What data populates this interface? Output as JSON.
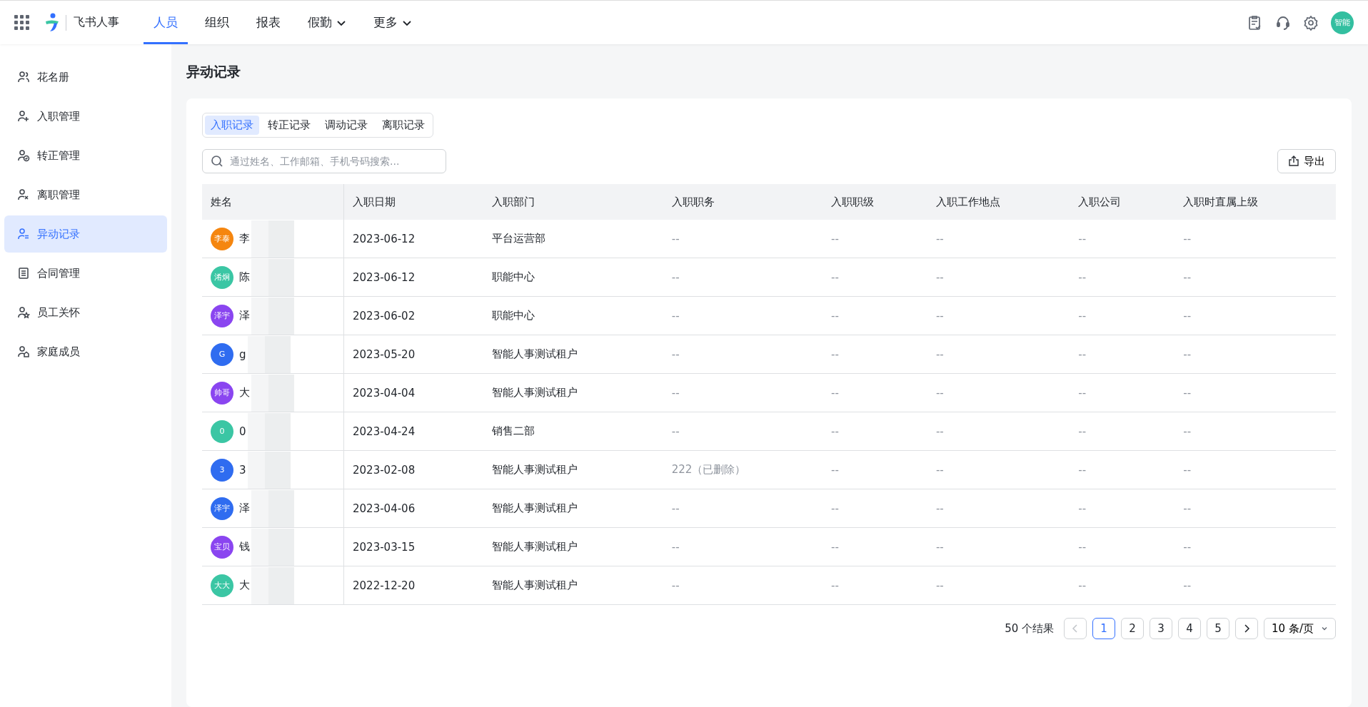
{
  "app": {
    "name": "飞书人事"
  },
  "nav": [
    {
      "label": "人员",
      "selected": true,
      "dropdown": false
    },
    {
      "label": "组织",
      "selected": false,
      "dropdown": false
    },
    {
      "label": "报表",
      "selected": false,
      "dropdown": false
    },
    {
      "label": "假勤",
      "selected": false,
      "dropdown": true
    },
    {
      "label": "更多",
      "selected": false,
      "dropdown": true
    }
  ],
  "user": {
    "avatar": "智能"
  },
  "sidebar": {
    "items": [
      {
        "label": "花名册",
        "kind": "people",
        "selected": false
      },
      {
        "label": "入职管理",
        "kind": "add",
        "selected": false
      },
      {
        "label": "转正管理",
        "kind": "check",
        "selected": false
      },
      {
        "label": "离职管理",
        "kind": "remove",
        "selected": false
      },
      {
        "label": "异动记录",
        "kind": "swap",
        "selected": true
      },
      {
        "label": "合同管理",
        "kind": "doc",
        "selected": false
      },
      {
        "label": "员工关怀",
        "kind": "star",
        "selected": false
      },
      {
        "label": "家庭成员",
        "kind": "home",
        "selected": false
      }
    ]
  },
  "page": {
    "title": "异动记录"
  },
  "tabs": [
    {
      "label": "入职记录",
      "selected": true
    },
    {
      "label": "转正记录",
      "selected": false
    },
    {
      "label": "调动记录",
      "selected": false
    },
    {
      "label": "离职记录",
      "selected": false
    }
  ],
  "search": {
    "placeholder": "通过姓名、工作邮箱、手机号码搜索..."
  },
  "export_button": "导出",
  "table": {
    "columns": [
      "姓名",
      "入职日期",
      "入职部门",
      "入职职务",
      "入职职级",
      "入职工作地点",
      "入职公司",
      "入职时直属上级"
    ],
    "rows": [
      {
        "avatar": "李泰",
        "color": "#f5860f",
        "cells": [
          "李",
          "2023-06-12",
          "平台运营部",
          "--",
          "--",
          "--",
          "--",
          "--"
        ]
      },
      {
        "avatar": "淆炯",
        "color": "#3bc6a4",
        "cells": [
          "陈",
          "2023-06-12",
          "职能中心",
          "--",
          "--",
          "--",
          "--",
          "--"
        ]
      },
      {
        "avatar": "泽宇",
        "color": "#8a45f0",
        "cells": [
          "泽",
          "2023-06-02",
          "职能中心",
          "--",
          "--",
          "--",
          "--",
          "--"
        ]
      },
      {
        "avatar": "G",
        "color": "#2f6cf0",
        "cells": [
          "g",
          "2023-05-20",
          "智能人事测试租户",
          "--",
          "--",
          "--",
          "--",
          "--"
        ]
      },
      {
        "avatar": "帅哥",
        "color": "#8a45f0",
        "cells": [
          "大",
          "2023-04-04",
          "智能人事测试租户",
          "--",
          "--",
          "--",
          "--",
          "--"
        ]
      },
      {
        "avatar": "0",
        "color": "#3bc6a4",
        "cells": [
          "0",
          "2023-04-24",
          "销售二部",
          "--",
          "--",
          "--",
          "--",
          "--"
        ]
      },
      {
        "avatar": "3",
        "color": "#2f6cf0",
        "cells": [
          "3",
          "2023-02-08",
          "智能人事测试租户",
          "222（已删除）",
          "--",
          "--",
          "--",
          "--"
        ]
      },
      {
        "avatar": "泽宇",
        "color": "#2f6cf0",
        "cells": [
          "泽",
          "2023-04-06",
          "智能人事测试租户",
          "--",
          "--",
          "--",
          "--",
          "--"
        ]
      },
      {
        "avatar": "宝贝",
        "color": "#8a45f0",
        "cells": [
          "钱",
          "2023-03-15",
          "智能人事测试租户",
          "--",
          "--",
          "--",
          "--",
          "--"
        ]
      },
      {
        "avatar": "大大",
        "color": "#3bc6a4",
        "cells": [
          "大",
          "2022-12-20",
          "智能人事测试租户",
          "--",
          "--",
          "--",
          "--",
          "--"
        ]
      }
    ]
  },
  "pagination": {
    "total": "50 个结果",
    "pages": [
      {
        "label": "1",
        "selected": true
      },
      {
        "label": "2",
        "selected": false
      },
      {
        "label": "3",
        "selected": false
      },
      {
        "label": "4",
        "selected": false
      },
      {
        "label": "5",
        "selected": false
      }
    ],
    "prev_disabled": true,
    "page_size": "10 条/页"
  }
}
